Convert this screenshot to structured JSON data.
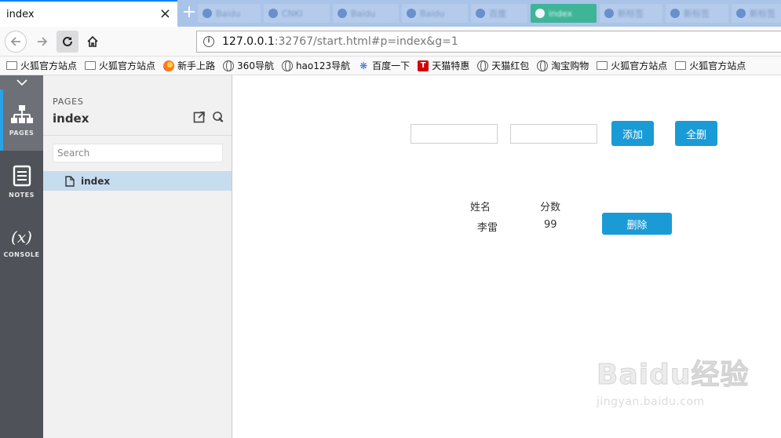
{
  "browser": {
    "active_tab": {
      "title": "index",
      "close": "×"
    },
    "new_tab_glyph": "+",
    "background_tabs": [
      {
        "label": "Baidu"
      },
      {
        "label": "CNKI"
      },
      {
        "label": "Baidu"
      },
      {
        "label": "Baidu"
      },
      {
        "label": "百度"
      },
      {
        "label": "index"
      },
      {
        "label": "新标签"
      },
      {
        "label": "新标签"
      },
      {
        "label": "新标签"
      }
    ],
    "url_host": "127.0.0.1",
    "url_rest": ":32767/start.html#p=index&g=1",
    "bookmarks": [
      {
        "label": "火狐官方站点",
        "icon": "folder-icon"
      },
      {
        "label": "火狐官方站点",
        "icon": "folder-icon"
      },
      {
        "label": "新手上路",
        "icon": "firefox-icon"
      },
      {
        "label": "360导航",
        "icon": "globe-icon"
      },
      {
        "label": "hao123导航",
        "icon": "globe-icon"
      },
      {
        "label": "百度一下",
        "icon": "paw-icon"
      },
      {
        "label": "天猫特惠",
        "icon": "tmall-icon"
      },
      {
        "label": "天猫红包",
        "icon": "globe-icon"
      },
      {
        "label": "淘宝购物",
        "icon": "globe-icon"
      },
      {
        "label": "火狐官方站点",
        "icon": "folder-icon"
      },
      {
        "label": "火狐官方站点",
        "icon": "folder-icon"
      }
    ]
  },
  "rail": {
    "items": [
      {
        "label": "PAGES",
        "icon": "sitemap-icon"
      },
      {
        "label": "NOTES",
        "icon": "notes-icon"
      },
      {
        "label": "CONSOLE",
        "icon": "variable-icon",
        "glyph": "(x)"
      }
    ]
  },
  "panel": {
    "section_label": "PAGES",
    "title": "index",
    "search_placeholder": "Search",
    "pages": [
      {
        "label": "index"
      }
    ]
  },
  "app": {
    "add_button": "添加",
    "clear_all_button": "全删",
    "table": {
      "headers": [
        "姓名",
        "分数"
      ],
      "rows": [
        {
          "name": "李雷",
          "score": "99",
          "action": "删除"
        }
      ]
    }
  },
  "watermark": {
    "brand": "Baidu经验",
    "url": "jingyan.baidu.com"
  },
  "colors": {
    "accent": "#1a9bd6",
    "tab_strip": "#a9c4e8",
    "rail": "#4f5258",
    "selected_page": "#c8dcef"
  }
}
